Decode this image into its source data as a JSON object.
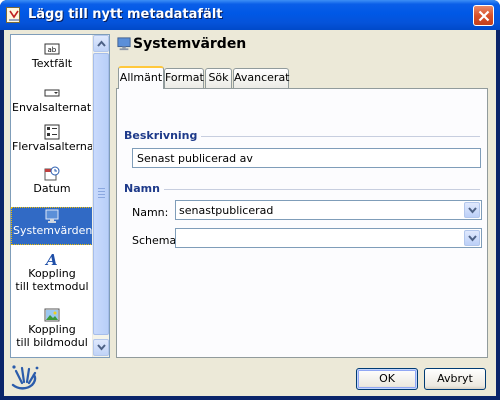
{
  "window": {
    "title": "Lägg till nytt metadatafält",
    "icon": "app-document-icon",
    "close_icon": "close-icon"
  },
  "sidebar": {
    "items": [
      {
        "label": "Textfält",
        "icon": "text-field-icon"
      },
      {
        "label": "Envalsalternativ",
        "icon": "single-choice-icon"
      },
      {
        "label": "Flervalsalternativ",
        "icon": "multi-choice-icon"
      },
      {
        "label": "Datum",
        "icon": "date-icon"
      },
      {
        "label": "Systemvärden",
        "icon": "system-values-icon",
        "selected": true
      },
      {
        "label": "Koppling",
        "label2": "till textmodul",
        "icon": "text-module-icon"
      },
      {
        "label": "Koppling",
        "label2": "till bildmodul",
        "icon": "image-module-icon"
      }
    ]
  },
  "header": {
    "title": "Systemvärden",
    "icon": "computer-icon"
  },
  "tabs": [
    {
      "label": "Allmänt",
      "active": true
    },
    {
      "label": "Format"
    },
    {
      "label": "Sök"
    },
    {
      "label": "Avancerat"
    }
  ],
  "description_group": {
    "title": "Beskrivning",
    "value": "Senast publicerad av"
  },
  "name_group": {
    "title": "Namn",
    "name_label": "Namn:",
    "name_value": "senastpublicerad",
    "schema_label": "Schema:",
    "schema_value": ""
  },
  "buttons": {
    "ok": "OK",
    "cancel": "Avbryt"
  },
  "colors": {
    "title_bar": "#0058e6",
    "selection": "#316ac5",
    "group_title": "#1e3a8a"
  }
}
